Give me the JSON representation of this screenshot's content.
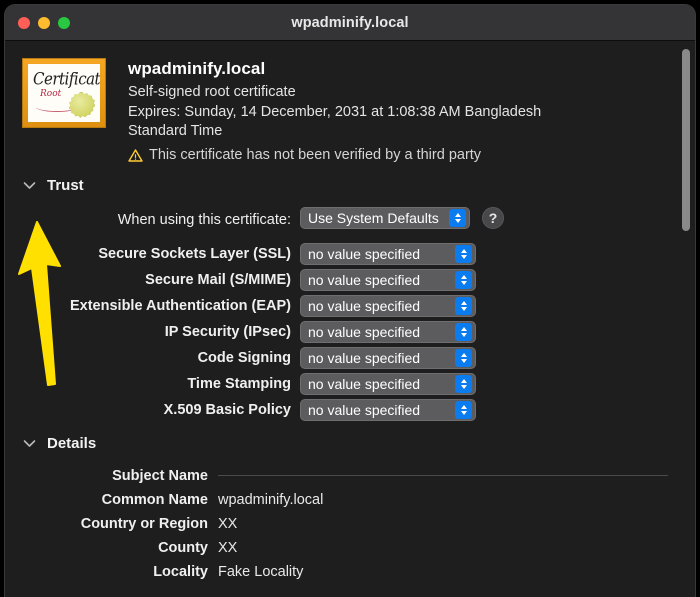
{
  "window": {
    "title": "wpadminify.local",
    "traffic_lights": [
      {
        "name": "close",
        "color": "#ff5f57"
      },
      {
        "name": "minimize",
        "color": "#febc2e"
      },
      {
        "name": "zoom",
        "color": "#28c840"
      }
    ]
  },
  "certificate": {
    "icon_label_main": "Certificate",
    "icon_label_sub": "Root",
    "name": "wpadminify.local",
    "type": "Self-signed root certificate",
    "expires": "Expires: Sunday, 14 December, 2031 at 1:08:38 AM Bangladesh Standard Time",
    "warning": "This certificate has not been verified by a third party"
  },
  "trust": {
    "section_title": "Trust",
    "when_using_label": "When using this certificate:",
    "when_using_value": "Use System Defaults",
    "help_label": "?",
    "rows": [
      {
        "label": "Secure Sockets Layer (SSL)",
        "value": "no value specified"
      },
      {
        "label": "Secure Mail (S/MIME)",
        "value": "no value specified"
      },
      {
        "label": "Extensible Authentication (EAP)",
        "value": "no value specified"
      },
      {
        "label": "IP Security (IPsec)",
        "value": "no value specified"
      },
      {
        "label": "Code Signing",
        "value": "no value specified"
      },
      {
        "label": "Time Stamping",
        "value": "no value specified"
      },
      {
        "label": "X.509 Basic Policy",
        "value": "no value specified"
      }
    ]
  },
  "details": {
    "section_title": "Details",
    "rows": [
      {
        "label": "Subject Name",
        "value": "",
        "is_header": true
      },
      {
        "label": "Common Name",
        "value": "wpadminify.local",
        "is_header": false
      },
      {
        "label": "Country or Region",
        "value": "XX",
        "is_header": false
      },
      {
        "label": "County",
        "value": "XX",
        "is_header": false
      },
      {
        "label": "Locality",
        "value": "Fake Locality",
        "is_header": false
      }
    ]
  },
  "annotation": {
    "arrow_color": "#ffe000"
  },
  "colors": {
    "window_background": "#1e1e1e",
    "titlebar_background": "#343436",
    "popup_background": "#5c5c5e",
    "stepper_accent": "#0a7cf0",
    "warning_yellow": "#ffcc33"
  }
}
